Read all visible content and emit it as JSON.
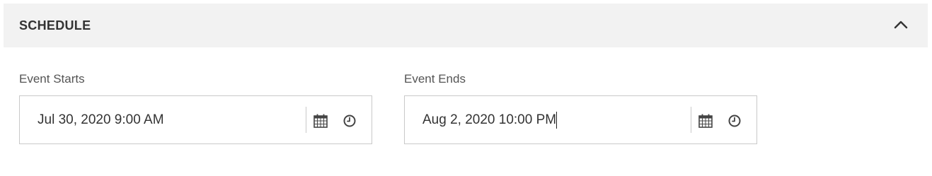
{
  "schedule": {
    "title": "SCHEDULE",
    "collapse_icon": "chevron-up-icon"
  },
  "event_starts": {
    "label": "Event Starts",
    "value": "Jul 30, 2020 9:00 AM",
    "calendar_icon": "calendar-icon",
    "clock_icon": "clock-icon"
  },
  "event_ends": {
    "label": "Event Ends",
    "value": "Aug 2, 2020 10:00 PM",
    "calendar_icon": "calendar-icon",
    "clock_icon": "clock-icon"
  }
}
